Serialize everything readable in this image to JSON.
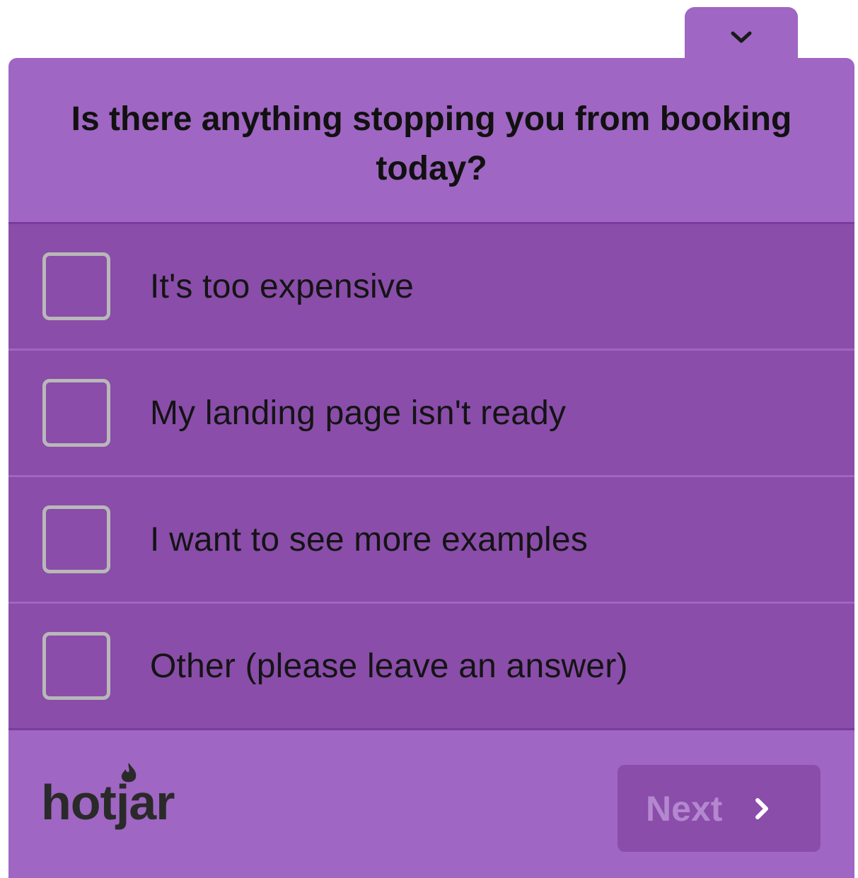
{
  "survey": {
    "question": "Is there anything stopping you from booking today?",
    "options": [
      {
        "label": "It's too expensive",
        "checked": false
      },
      {
        "label": "My landing page isn't ready",
        "checked": false
      },
      {
        "label": "I want to see more examples",
        "checked": false
      },
      {
        "label": "Other (please leave an answer)",
        "checked": false
      }
    ],
    "next_label": "Next",
    "collapse_icon": "chevron-down-icon",
    "next_icon": "chevron-right-icon"
  },
  "branding": {
    "logo_text": "hotjar"
  },
  "colors": {
    "panel": "#a066c3",
    "option_bg": "#8a4daa",
    "checkbox_border": "#b8b8b8",
    "next_text": "#b487cf"
  }
}
